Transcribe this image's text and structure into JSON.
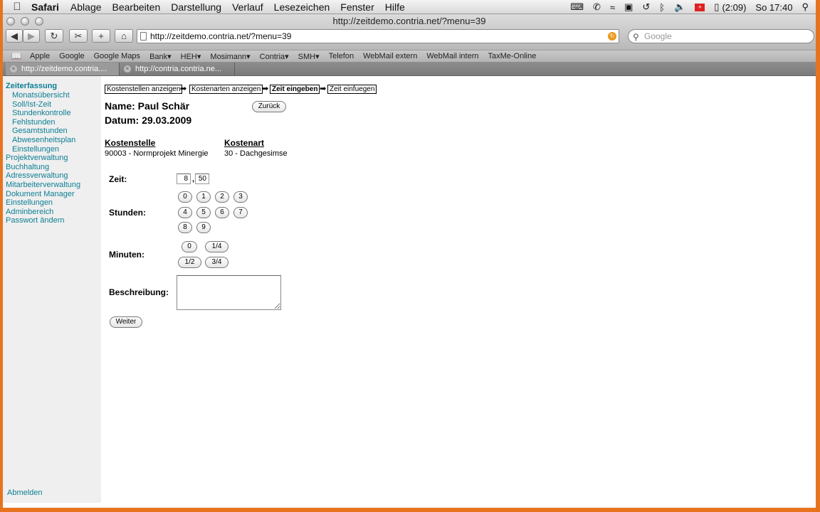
{
  "menubar": {
    "app": "Safari",
    "items": [
      "Ablage",
      "Bearbeiten",
      "Darstellung",
      "Verlauf",
      "Lesezeichen",
      "Fenster",
      "Hilfe"
    ],
    "battery": "(2:09)",
    "clock": "So 17:40"
  },
  "window": {
    "title": "http://zeitdemo.contria.net/?menu=39"
  },
  "toolbar": {
    "url": "http://zeitdemo.contria.net/?menu=39",
    "search_placeholder": "Google"
  },
  "bookmarks": [
    "Apple",
    "Google",
    "Google Maps",
    "Bank▾",
    "HEH▾",
    "Mosimann▾",
    "Contria▾",
    "SMH▾",
    "Telefon",
    "WebMail extern",
    "WebMail intern",
    "TaxMe-Online"
  ],
  "tabs": [
    "http://zeitdemo.contria....",
    "http://contria.contria.ne..."
  ],
  "sidebar": {
    "heading": "Zeiterfassung",
    "sub_items": [
      "Monatsübersicht",
      "Soll/Ist-Zeit",
      "Stundenkontrolle",
      "Fehlstunden",
      "Gesamtstunden",
      "Abwesenheitsplan",
      "Einstellungen"
    ],
    "main_items": [
      "Projektverwaltung",
      "Buchhaltung",
      "Adressverwaltung",
      "Mitarbeiterverwaltung",
      "Dokument Manager",
      "Einstellungen",
      "Adminbereich",
      "Passwort ändern"
    ],
    "logout": "Abmelden"
  },
  "breadcrumb": [
    "Kostenstellen anzeigen",
    "Kostenarten anzeigen",
    "Zeit eingeben",
    "Zeit einfuegen"
  ],
  "form": {
    "name": "Name: Paul Schär",
    "date": "Datum: 29.03.2009",
    "back": "Zurück",
    "kostenstelle_label": "Kostenstelle",
    "kostenstelle_value": "90003 - Normprojekt Minergie",
    "kostenart_label": "Kostenart",
    "kostenart_value": "30 - Dachgesimse",
    "zeit_label": "Zeit:",
    "hours_value": "8",
    "separator": ",",
    "minutes_value": "50",
    "stunden_label": "Stunden:",
    "hour_buttons": [
      "0",
      "1",
      "2",
      "3",
      "4",
      "5",
      "6",
      "7",
      "8",
      "9"
    ],
    "minuten_label": "Minuten:",
    "minute_buttons": [
      "0",
      "1/4",
      "1/2",
      "3/4"
    ],
    "beschreibung_label": "Beschreibung:",
    "next": "Weiter"
  }
}
